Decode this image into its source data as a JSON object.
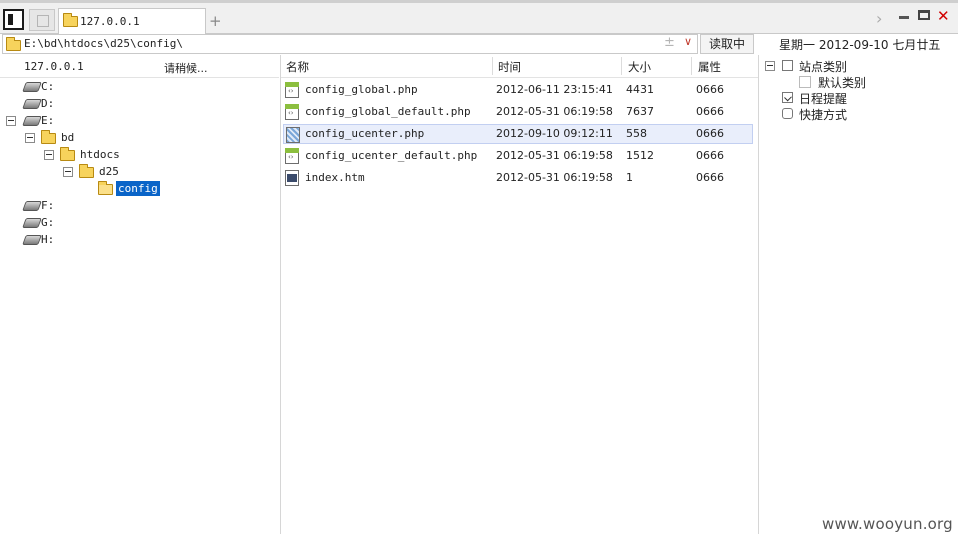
{
  "tabs": {
    "active_label": "127.0.0.1",
    "new_tab": "+"
  },
  "window": {
    "forward": "›",
    "close": "✕"
  },
  "path_bar": {
    "path": "E:\\bd\\htdocs\\d25\\config\\",
    "plus": "±",
    "dropdown": "∨",
    "read_button": "读取中"
  },
  "left": {
    "host": "127.0.0.1",
    "status": "请稍候...",
    "tree": [
      {
        "label": "C:"
      },
      {
        "label": "D:"
      },
      {
        "label": "E:"
      },
      {
        "label": "bd"
      },
      {
        "label": "htdocs"
      },
      {
        "label": "d25"
      },
      {
        "label": "config"
      },
      {
        "label": "F:"
      },
      {
        "label": "G:"
      },
      {
        "label": "H:"
      }
    ]
  },
  "files": {
    "columns": {
      "name": "名称",
      "time": "时间",
      "size": "大小",
      "attr": "属性"
    },
    "rows": [
      {
        "name": "config_global.php",
        "time": "2012-06-11 23:15:41",
        "size": "4431",
        "attr": "0666"
      },
      {
        "name": "config_global_default.php",
        "time": "2012-05-31 06:19:58",
        "size": "7637",
        "attr": "0666"
      },
      {
        "name": "config_ucenter.php",
        "time": "2012-09-10 09:12:11",
        "size": "558",
        "attr": "0666"
      },
      {
        "name": "config_ucenter_default.php",
        "time": "2012-05-31 06:19:58",
        "size": "1512",
        "attr": "0666"
      },
      {
        "name": "index.htm",
        "time": "2012-05-31 06:19:58",
        "size": "1",
        "attr": "0666"
      }
    ]
  },
  "right": {
    "date": "星期一  2012-09-10  七月廿五",
    "categories": {
      "site": "站点类别",
      "default": "默认类别",
      "schedule": "日程提醒",
      "shortcut": "快捷方式"
    }
  },
  "watermark": "www.wooyun.org"
}
